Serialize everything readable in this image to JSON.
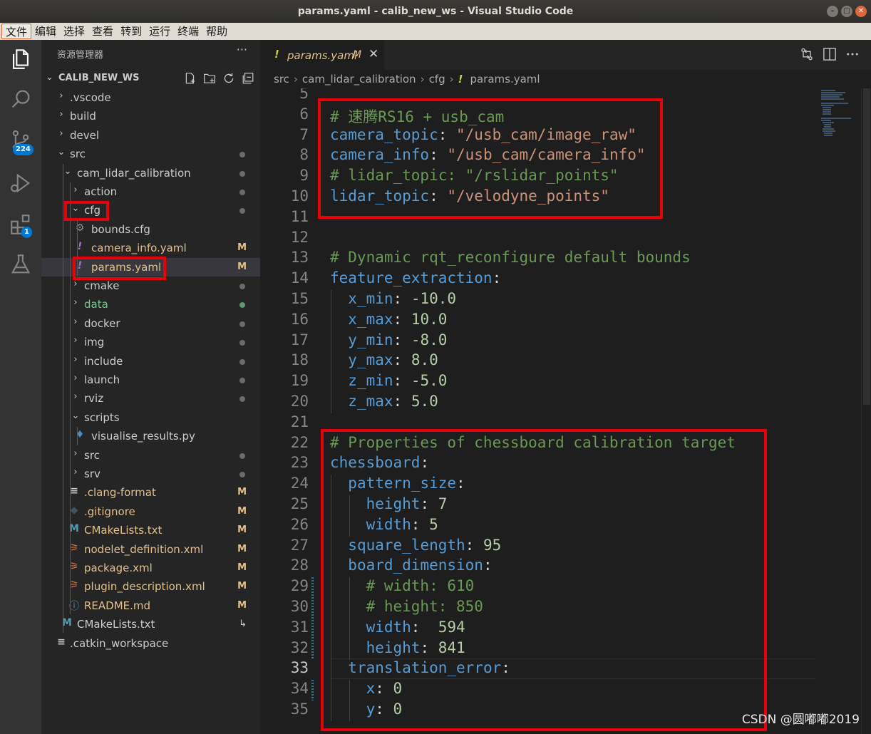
{
  "window": {
    "title": "params.yaml - calib_new_ws - Visual Studio Code"
  },
  "menu": [
    "文件",
    "编辑",
    "选择",
    "查看",
    "转到",
    "运行",
    "终端",
    "帮助"
  ],
  "activity": {
    "scm_badge": "224",
    "extensions_badge": "1"
  },
  "explorer": {
    "title": "资源管理器",
    "more": "···",
    "workspace": "CALIB_NEW_WS",
    "tree": [
      {
        "label": ".vscode",
        "status": ""
      },
      {
        "label": "build",
        "status": ""
      },
      {
        "label": "devel",
        "status": ""
      },
      {
        "label": "src",
        "status": "dot"
      },
      {
        "label": "cam_lidar_calibration",
        "status": "dot"
      },
      {
        "label": "action",
        "status": "dot"
      },
      {
        "label": "cfg",
        "status": "dot"
      },
      {
        "label": "bounds.cfg",
        "status": ""
      },
      {
        "label": "camera_info.yaml",
        "status": "M"
      },
      {
        "label": "params.yaml",
        "status": "M"
      },
      {
        "label": "cmake",
        "status": "dot"
      },
      {
        "label": "data",
        "status": "dot"
      },
      {
        "label": "docker",
        "status": "dot"
      },
      {
        "label": "img",
        "status": "dot"
      },
      {
        "label": "include",
        "status": "dot"
      },
      {
        "label": "launch",
        "status": "dot"
      },
      {
        "label": "rviz",
        "status": "dot"
      },
      {
        "label": "scripts",
        "status": ""
      },
      {
        "label": "visualise_results.py",
        "status": ""
      },
      {
        "label": "src",
        "status": "dot"
      },
      {
        "label": "srv",
        "status": "dot"
      },
      {
        "label": ".clang-format",
        "status": "M"
      },
      {
        "label": ".gitignore",
        "status": "M"
      },
      {
        "label": "CMakeLists.txt",
        "status": "M"
      },
      {
        "label": "nodelet_definition.xml",
        "status": "M"
      },
      {
        "label": "package.xml",
        "status": "M"
      },
      {
        "label": "plugin_description.xml",
        "status": "M"
      },
      {
        "label": "README.md",
        "status": "M"
      },
      {
        "label": "CMakeLists.txt",
        "status": "↳"
      },
      {
        "label": ".catkin_workspace",
        "status": ""
      }
    ]
  },
  "tab": {
    "icon": "!",
    "label": "params.yaml",
    "modified": "M",
    "close": "✕"
  },
  "breadcrumb": [
    "src",
    "cam_lidar_calibration",
    "cfg",
    "params.yaml"
  ],
  "editor": {
    "line_numbers": [
      "5",
      "6",
      "7",
      "8",
      "9",
      "10",
      "11",
      "12",
      "13",
      "14",
      "15",
      "16",
      "17",
      "18",
      "19",
      "20",
      "21",
      "22",
      "23",
      "24",
      "25",
      "26",
      "27",
      "28",
      "29",
      "30",
      "31",
      "32",
      "33",
      "34",
      "35"
    ],
    "current_line": "33",
    "lines": [
      [],
      [
        [
          "c",
          "# 速腾RS16 + usb_cam"
        ]
      ],
      [
        [
          "k",
          "camera_topic"
        ],
        [
          "p",
          ": "
        ],
        [
          "s",
          "\"/usb_cam/image_raw\""
        ]
      ],
      [
        [
          "k",
          "camera_info"
        ],
        [
          "p",
          ": "
        ],
        [
          "s",
          "\"/usb_cam/camera_info\""
        ]
      ],
      [
        [
          "c",
          "# lidar_topic: \"/rslidar_points\""
        ]
      ],
      [
        [
          "k",
          "lidar_topic"
        ],
        [
          "p",
          ": "
        ],
        [
          "s",
          "\"/velodyne_points\""
        ]
      ],
      [],
      [],
      [
        [
          "c",
          "# Dynamic rqt_reconfigure default bounds"
        ]
      ],
      [
        [
          "k",
          "feature_extraction"
        ],
        [
          "p",
          ":"
        ]
      ],
      [
        [
          "p",
          "  "
        ],
        [
          "k",
          "x_min"
        ],
        [
          "p",
          ": "
        ],
        [
          "n",
          "-10.0"
        ]
      ],
      [
        [
          "p",
          "  "
        ],
        [
          "k",
          "x_max"
        ],
        [
          "p",
          ": "
        ],
        [
          "n",
          "10.0"
        ]
      ],
      [
        [
          "p",
          "  "
        ],
        [
          "k",
          "y_min"
        ],
        [
          "p",
          ": "
        ],
        [
          "n",
          "-8.0"
        ]
      ],
      [
        [
          "p",
          "  "
        ],
        [
          "k",
          "y_max"
        ],
        [
          "p",
          ": "
        ],
        [
          "n",
          "8.0"
        ]
      ],
      [
        [
          "p",
          "  "
        ],
        [
          "k",
          "z_min"
        ],
        [
          "p",
          ": "
        ],
        [
          "n",
          "-5.0"
        ]
      ],
      [
        [
          "p",
          "  "
        ],
        [
          "k",
          "z_max"
        ],
        [
          "p",
          ": "
        ],
        [
          "n",
          "5.0"
        ]
      ],
      [],
      [
        [
          "c",
          "# Properties of chessboard calibration target"
        ]
      ],
      [
        [
          "k",
          "chessboard"
        ],
        [
          "p",
          ":"
        ]
      ],
      [
        [
          "p",
          "  "
        ],
        [
          "k",
          "pattern_size"
        ],
        [
          "p",
          ":"
        ]
      ],
      [
        [
          "p",
          "    "
        ],
        [
          "k",
          "height"
        ],
        [
          "p",
          ": "
        ],
        [
          "n",
          "7"
        ]
      ],
      [
        [
          "p",
          "    "
        ],
        [
          "k",
          "width"
        ],
        [
          "p",
          ": "
        ],
        [
          "n",
          "5"
        ]
      ],
      [
        [
          "p",
          "  "
        ],
        [
          "k",
          "square_length"
        ],
        [
          "p",
          ": "
        ],
        [
          "n",
          "95"
        ]
      ],
      [
        [
          "p",
          "  "
        ],
        [
          "k",
          "board_dimension"
        ],
        [
          "p",
          ":"
        ]
      ],
      [
        [
          "p",
          "    "
        ],
        [
          "c",
          "# width: 610"
        ]
      ],
      [
        [
          "p",
          "    "
        ],
        [
          "c",
          "# height: 850"
        ]
      ],
      [
        [
          "p",
          "    "
        ],
        [
          "k",
          "width"
        ],
        [
          "p",
          ":  "
        ],
        [
          "n",
          "594"
        ]
      ],
      [
        [
          "p",
          "    "
        ],
        [
          "k",
          "height"
        ],
        [
          "p",
          ": "
        ],
        [
          "n",
          "841"
        ]
      ],
      [
        [
          "p",
          "  "
        ],
        [
          "k",
          "translation_error"
        ],
        [
          "p",
          ":"
        ]
      ],
      [
        [
          "p",
          "    "
        ],
        [
          "k",
          "x"
        ],
        [
          "p",
          ": "
        ],
        [
          "n",
          "0"
        ]
      ],
      [
        [
          "p",
          "    "
        ],
        [
          "k",
          "y"
        ],
        [
          "p",
          ": "
        ],
        [
          "n",
          "0"
        ]
      ]
    ]
  },
  "watermark": "CSDN @圆嘟嘟2019"
}
